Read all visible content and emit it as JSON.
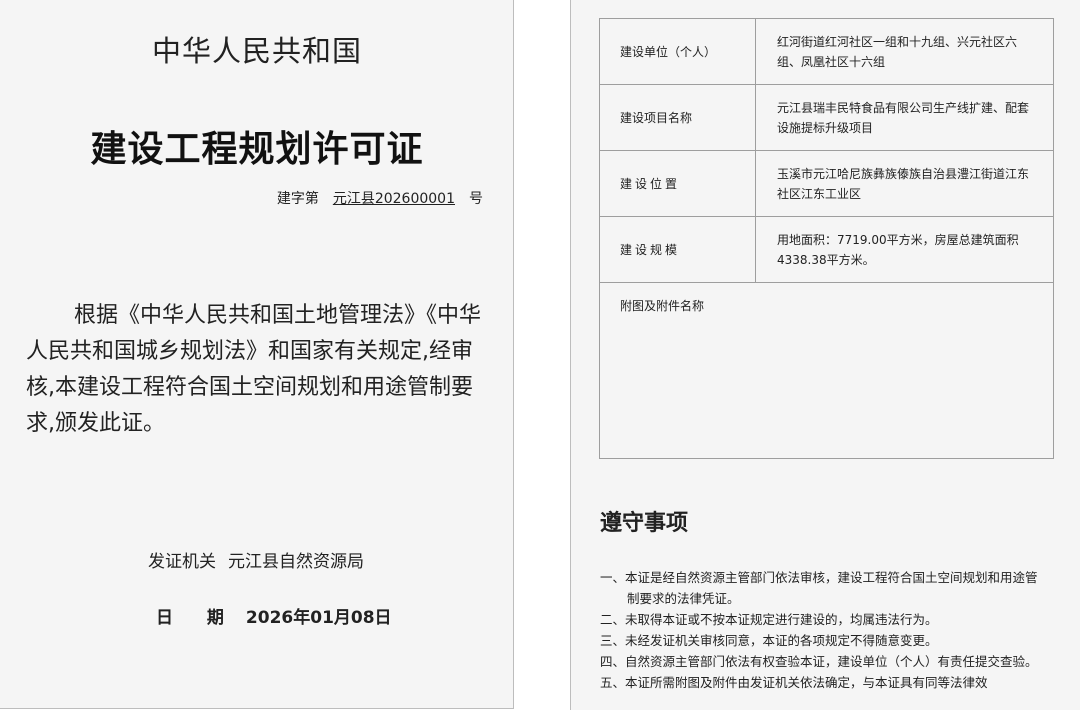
{
  "left_page": {
    "country": "中华人民共和国",
    "title": "建设工程规划许可证",
    "permit_prefix": "建字第",
    "permit_number": "元江县202600001",
    "permit_suffix": "号",
    "body": "根据《中华人民共和国土地管理法》《中华人民共和国城乡规划法》和国家有关规定,经审核,本建设工程符合国土空间规划和用途管制要求,颁发此证。",
    "issuer_label": "发证机关",
    "issuer": "元江县自然资源局",
    "date_label": "日 期",
    "date": "2026年01月08日"
  },
  "right_page": {
    "table": [
      {
        "key": "建设单位（个人）",
        "value": "红河街道红河社区一组和十九组、兴元社区六组、凤凰社区十六组"
      },
      {
        "key": "建设项目名称",
        "value": "元江县瑞丰民特食品有限公司生产线扩建、配套设施提标升级项目"
      },
      {
        "key": "建设位置",
        "value": "玉溪市元江哈尼族彝族傣族自治县澧江街道江东社区江东工业区"
      },
      {
        "key": "建设规模",
        "value": "用地面积：7719.00平方米，房屋总建筑面积4338.38平方米。"
      }
    ],
    "attachments_label": "附图及附件名称",
    "notes_title": "遵守事项",
    "notes": [
      "一、本证是经自然资源主管部门依法审核，建设工程符合国土空间规划和用途管制要求的法律凭证。",
      "二、未取得本证或不按本证规定进行建设的，均属违法行为。",
      "三、未经发证机关审核同意，本证的各项规定不得随意变更。",
      "四、自然资源主管部门依法有权查验本证，建设单位（个人）有责任提交查验。",
      "五、本证所需附图及附件由发证机关依法确定，与本证具有同等法律效"
    ]
  }
}
